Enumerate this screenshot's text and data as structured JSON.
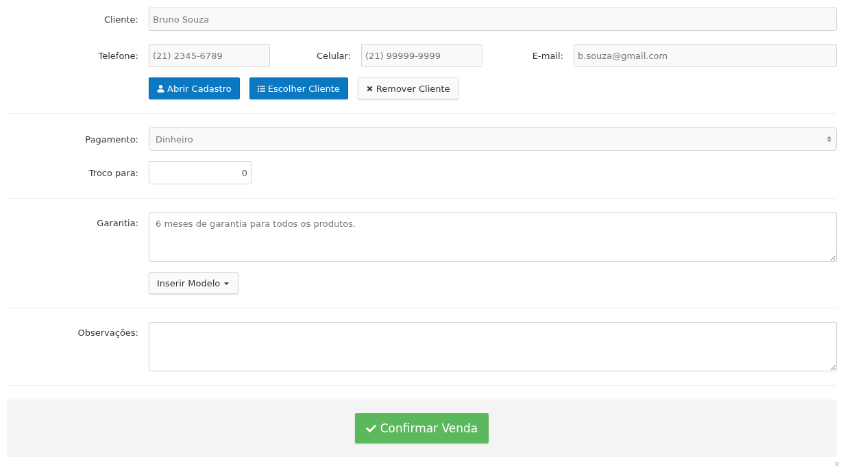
{
  "cliente": {
    "label": "Cliente:",
    "value": "Bruno Souza"
  },
  "contacts": [
    {
      "label": "Telefone:",
      "value": "(21) 2345-6789"
    },
    {
      "label": "Celular:",
      "value": "(21) 99999-9999"
    },
    {
      "label": "E-mail:",
      "value": "b.souza@gmail.com"
    }
  ],
  "client_buttons": [
    {
      "kind": "user",
      "label": "Abrir Cadastro"
    },
    {
      "kind": "list",
      "label": "Escolher Cliente"
    },
    {
      "kind": "remove",
      "label": "Remover Cliente"
    }
  ],
  "pagamento": {
    "label": "Pagamento:",
    "value": "Dinheiro"
  },
  "troco": {
    "label": "Troco para:",
    "value": "0"
  },
  "garantia": {
    "label": "Garantia:",
    "value": "6 meses de garantia para todos os produtos."
  },
  "inserir_modelo": {
    "label": "Inserir Modelo"
  },
  "observacoes": {
    "label": "Observações:"
  },
  "confirm_button": {
    "label": "Confirmar Venda"
  }
}
